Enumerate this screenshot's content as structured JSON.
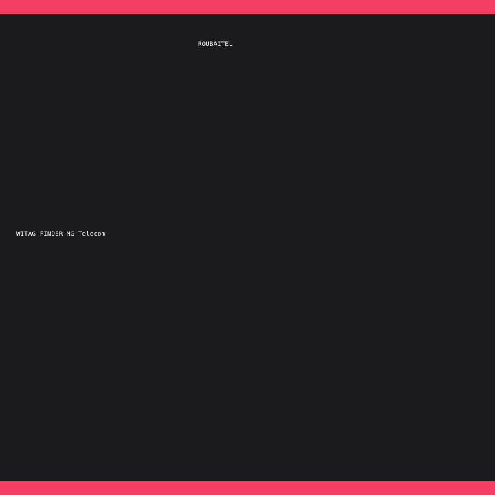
{
  "header": {
    "title": "ROUBAITEL"
  },
  "main": {
    "status_line": "WITAG FINDER MG Telecom"
  },
  "colors": {
    "accent": "#f43f62",
    "background": "#1b1b1d",
    "text": "#ffffff"
  }
}
